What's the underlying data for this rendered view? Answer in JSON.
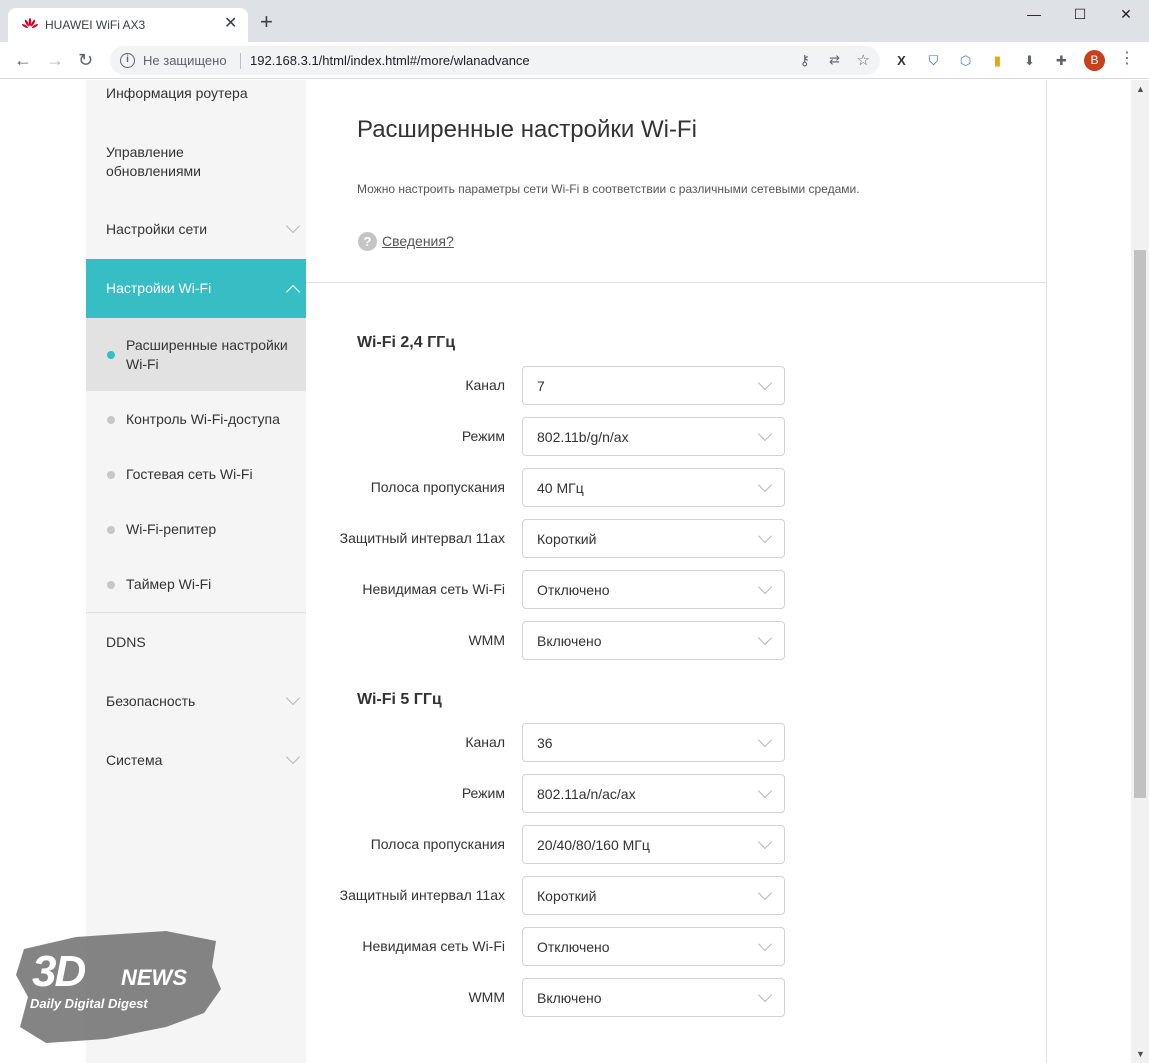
{
  "browser": {
    "tab_title": "HUAWEI WiFi AX3",
    "tab_close": "✕",
    "new_tab": "+",
    "win_min": "—",
    "win_max": "☐",
    "win_close": "✕",
    "security_label": "Не защищено",
    "url": "192.168.3.1/html/index.html#/more/wlanadvance",
    "avatar_letter": "B",
    "brand_color": "#c5421d"
  },
  "sidebar": {
    "accent": "#36bec4",
    "items": [
      {
        "label": "Информация роутера"
      },
      {
        "label_line1": "Управление",
        "label_line2": "обновлениями"
      },
      {
        "label": "Настройки сети"
      },
      {
        "label": "Настройки Wi-Fi"
      },
      {
        "label": "DDNS"
      },
      {
        "label": "Безопасность"
      },
      {
        "label": "Система"
      }
    ],
    "wifi_sub": [
      {
        "label_line1": "Расширенные настройки",
        "label_line2": "Wi-Fi"
      },
      {
        "label": "Контроль Wi-Fi-доступа"
      },
      {
        "label": "Гостевая сеть Wi-Fi"
      },
      {
        "label": "Wi-Fi-репитер"
      },
      {
        "label": "Таймер Wi-Fi"
      }
    ]
  },
  "main": {
    "title": "Расширенные настройки Wi-Fi",
    "description": "Можно настроить параметры сети Wi-Fi в соответствии с различными сетевыми средами.",
    "help_link": "Сведения?",
    "band24": {
      "title": "Wi-Fi 2,4 ГГц",
      "rows": [
        {
          "label": "Канал",
          "value": "7"
        },
        {
          "label": "Режим",
          "value": "802.11b/g/n/ax"
        },
        {
          "label": "Полоса пропускания",
          "value": "40 МГц"
        },
        {
          "label": "Защитный интервал 11ax",
          "value": "Короткий"
        },
        {
          "label": "Невидимая сеть Wi-Fi",
          "value": "Отключено"
        },
        {
          "label": "WMM",
          "value": "Включено"
        }
      ]
    },
    "band5": {
      "title": "Wi-Fi 5 ГГц",
      "rows": [
        {
          "label": "Канал",
          "value": "36"
        },
        {
          "label": "Режим",
          "value": "802.11a/n/ac/ax"
        },
        {
          "label": "Полоса пропускания",
          "value": "20/40/80/160 МГц"
        },
        {
          "label": "Защитный интервал 11ax",
          "value": "Короткий"
        },
        {
          "label": "Невидимая сеть Wi-Fi",
          "value": "Отключено"
        },
        {
          "label": "WMM",
          "value": "Включено"
        }
      ]
    }
  },
  "watermark": {
    "big": "3D",
    "news": "NEWS",
    "sub": "Daily Digital Digest"
  }
}
